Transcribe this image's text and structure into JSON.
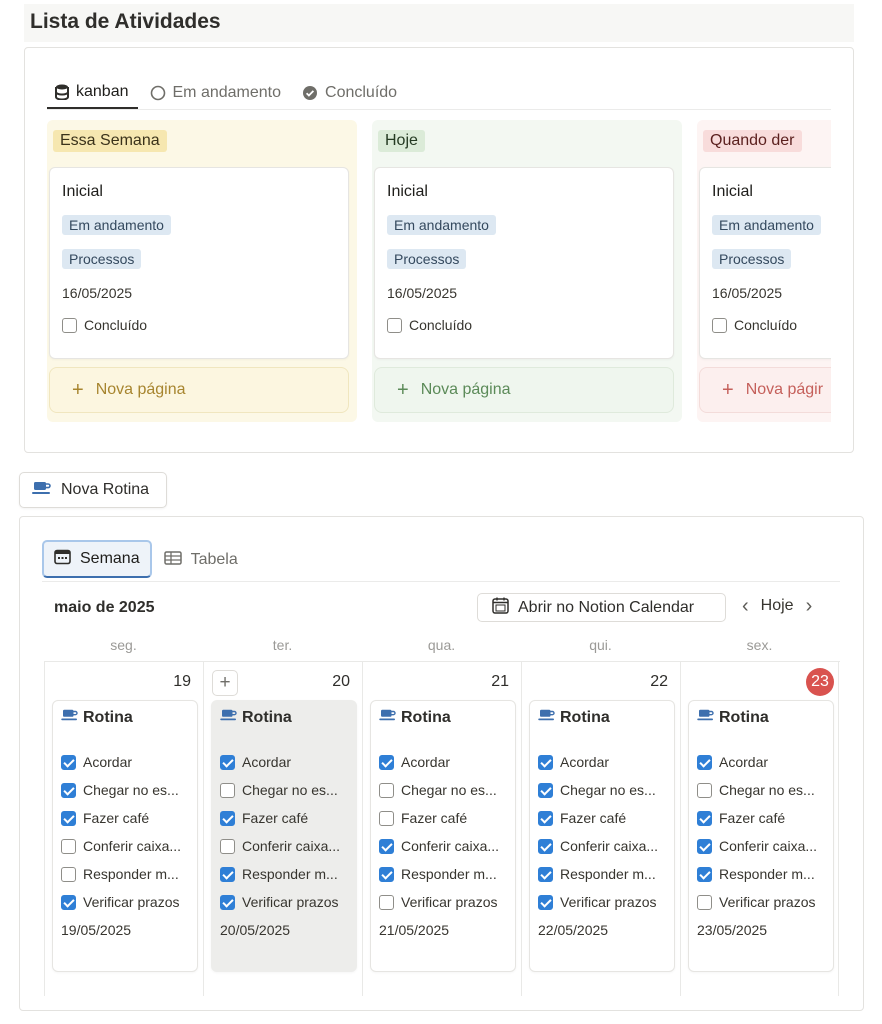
{
  "page_title": "Lista de Atividades",
  "kanban": {
    "tabs": [
      {
        "label": "kanban",
        "icon": "database-icon",
        "active": true
      },
      {
        "label": "Em andamento",
        "icon": "circle-outline-icon",
        "active": false
      },
      {
        "label": "Concluído",
        "icon": "check-circle-icon",
        "active": false
      }
    ],
    "columns": [
      {
        "label": "Essa Semana",
        "bg": "#fcf8e6",
        "label_bg": "#f6e7b0",
        "label_color": "#3a321a",
        "new_bg": "#fcf6e0",
        "new_border": "#f0e6bf",
        "new_color": "#a7852f",
        "card": {
          "title": "Inicial",
          "status": "Em andamento",
          "area": "Processos",
          "date": "16/05/2025",
          "done_label": "Concluído",
          "done": false
        },
        "new_label": "Nova página"
      },
      {
        "label": "Hoje",
        "bg": "#f3f8f2",
        "label_bg": "#dbebd8",
        "label_color": "#243a22",
        "new_bg": "#eff6ee",
        "new_border": "#dfeadc",
        "new_color": "#5b8a58",
        "card": {
          "title": "Inicial",
          "status": "Em andamento",
          "area": "Processos",
          "date": "16/05/2025",
          "done_label": "Concluído",
          "done": false
        },
        "new_label": "Nova página"
      },
      {
        "label": "Quando der",
        "bg": "#fdf4f3",
        "label_bg": "#f8dcdb",
        "label_color": "#5a1f1d",
        "new_bg": "#fcefee",
        "new_border": "#f3dcda",
        "new_color": "#c5605b",
        "card": {
          "title": "Inicial",
          "status": "Em andamento",
          "area": "Processos",
          "date": "16/05/2025",
          "done_label": "Concluído",
          "done": false
        },
        "new_label": "Nova págir"
      }
    ]
  },
  "new_routine_button": "Nova Rotina",
  "calendar": {
    "tabs": [
      {
        "label": "Semana",
        "icon": "calendar-icon",
        "active": true
      },
      {
        "label": "Tabela",
        "icon": "table-icon",
        "active": false
      }
    ],
    "month": "maio de 2025",
    "open_button": "Abrir no Notion Calendar",
    "today_button": "Hoje",
    "weekdays": [
      "seg.",
      "ter.",
      "qua.",
      "qui.",
      "sex."
    ],
    "days": [
      {
        "number": "19",
        "today": false,
        "highlight": false,
        "show_add": false,
        "card_title": "Rotina",
        "date": "19/05/2025",
        "tasks": [
          {
            "label": "Acordar",
            "done": true
          },
          {
            "label": "Chegar no es...",
            "done": true
          },
          {
            "label": "Fazer café",
            "done": true
          },
          {
            "label": "Conferir caixa...",
            "done": false
          },
          {
            "label": "Responder m...",
            "done": false
          },
          {
            "label": "Verificar prazos",
            "done": true
          }
        ]
      },
      {
        "number": "20",
        "today": false,
        "highlight": true,
        "show_add": true,
        "add_label": "+",
        "card_title": "Rotina",
        "date": "20/05/2025",
        "tasks": [
          {
            "label": "Acordar",
            "done": true
          },
          {
            "label": "Chegar no es...",
            "done": false
          },
          {
            "label": "Fazer café",
            "done": true
          },
          {
            "label": "Conferir caixa...",
            "done": false
          },
          {
            "label": "Responder m...",
            "done": true
          },
          {
            "label": "Verificar prazos",
            "done": true
          }
        ]
      },
      {
        "number": "21",
        "today": false,
        "highlight": false,
        "show_add": false,
        "card_title": "Rotina",
        "date": "21/05/2025",
        "tasks": [
          {
            "label": "Acordar",
            "done": true
          },
          {
            "label": "Chegar no es...",
            "done": false
          },
          {
            "label": "Fazer café",
            "done": false
          },
          {
            "label": "Conferir caixa...",
            "done": true
          },
          {
            "label": "Responder m...",
            "done": true
          },
          {
            "label": "Verificar prazos",
            "done": false
          }
        ]
      },
      {
        "number": "22",
        "today": false,
        "highlight": false,
        "show_add": false,
        "card_title": "Rotina",
        "date": "22/05/2025",
        "tasks": [
          {
            "label": "Acordar",
            "done": true
          },
          {
            "label": "Chegar no es...",
            "done": true
          },
          {
            "label": "Fazer café",
            "done": true
          },
          {
            "label": "Conferir caixa...",
            "done": true
          },
          {
            "label": "Responder m...",
            "done": true
          },
          {
            "label": "Verificar prazos",
            "done": true
          }
        ]
      },
      {
        "number": "23",
        "today": true,
        "highlight": false,
        "show_add": false,
        "card_title": "Rotina",
        "date": "23/05/2025",
        "tasks": [
          {
            "label": "Acordar",
            "done": true
          },
          {
            "label": "Chegar no es...",
            "done": false
          },
          {
            "label": "Fazer café",
            "done": true
          },
          {
            "label": "Conferir caixa...",
            "done": true
          },
          {
            "label": "Responder m...",
            "done": true
          },
          {
            "label": "Verificar prazos",
            "done": false
          }
        ]
      }
    ]
  },
  "colors": {
    "checkbox_checked": "#2f7fd6",
    "today_badge": "#d9534f"
  }
}
